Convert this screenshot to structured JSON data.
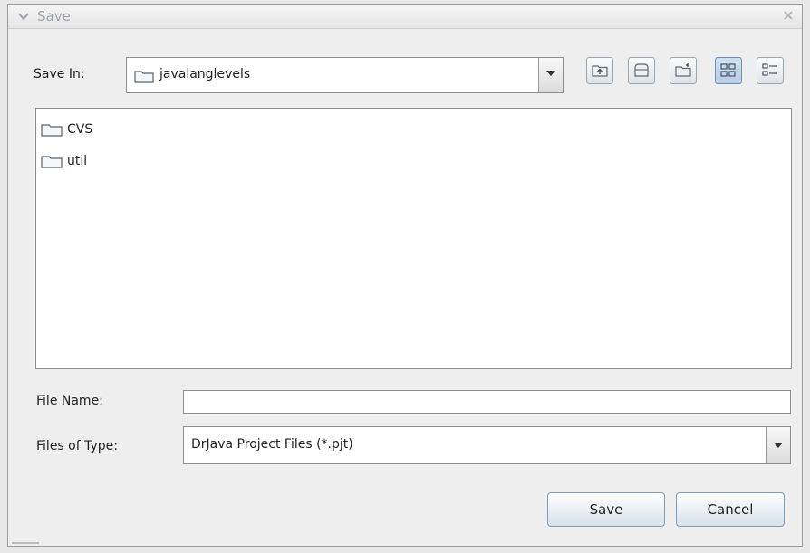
{
  "window": {
    "title": "Save"
  },
  "save_in": {
    "label": "Save In:",
    "selected": "javalanglevels",
    "toolbar_icons": [
      "up-one-level-icon",
      "home-icon",
      "new-folder-icon",
      "list-view-icon",
      "details-view-icon"
    ]
  },
  "files": [
    {
      "name": "CVS",
      "icon": "folder-icon"
    },
    {
      "name": "util",
      "icon": "folder-icon"
    }
  ],
  "file_name": {
    "label": "File Name:",
    "value": ""
  },
  "file_type": {
    "label": "Files of Type:",
    "selected": "DrJava Project Files (*.pjt)"
  },
  "buttons": {
    "save": "Save",
    "cancel": "Cancel"
  }
}
